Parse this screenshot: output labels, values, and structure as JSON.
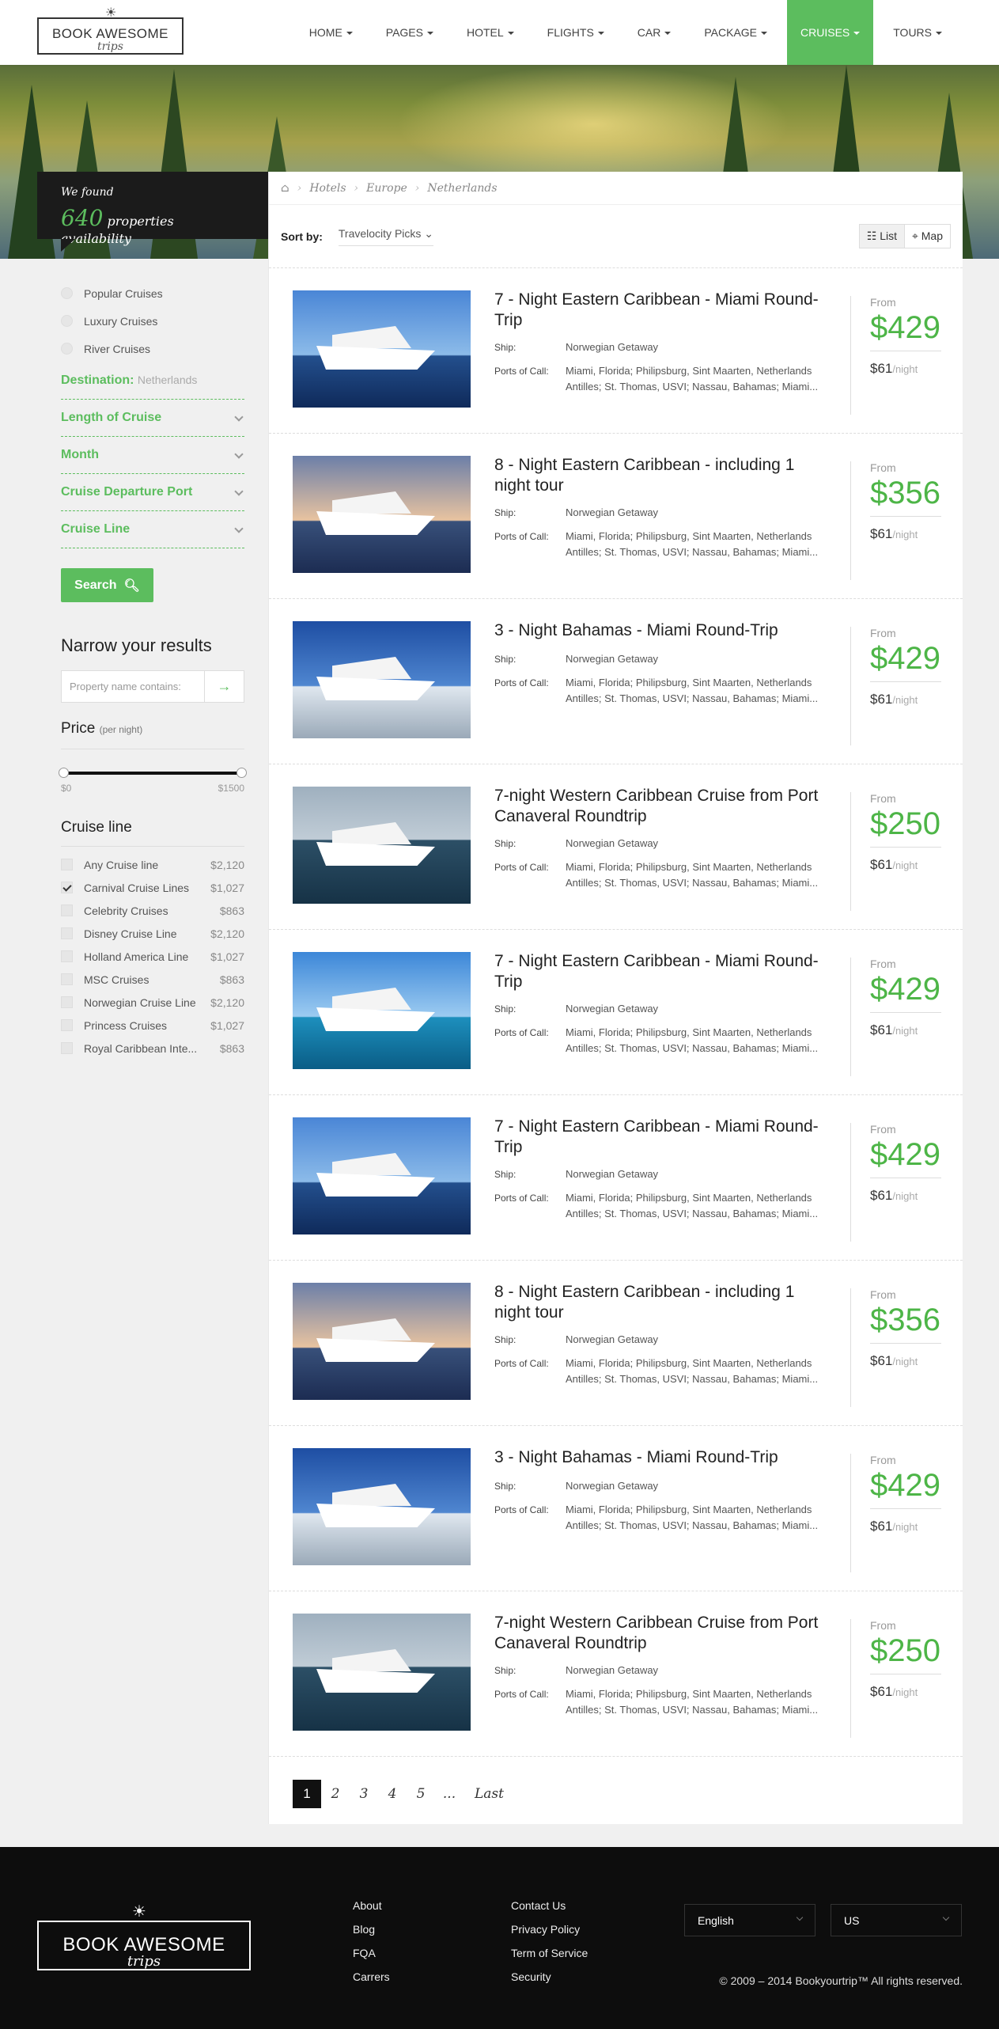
{
  "brand": {
    "name": "BOOK AWESOME",
    "tagline": "trips"
  },
  "nav": [
    {
      "label": "HOME"
    },
    {
      "label": "PAGES"
    },
    {
      "label": "HOTEL"
    },
    {
      "label": "FLIGHTS"
    },
    {
      "label": "CAR"
    },
    {
      "label": "PACKAGE"
    },
    {
      "label": "CRUISES",
      "active": true
    },
    {
      "label": "TOURS"
    }
  ],
  "found": {
    "prefix": "We found",
    "count": "640",
    "suffix": "properties availability"
  },
  "types": [
    "Popular Cruises",
    "Luxury Cruises",
    "River Cruises"
  ],
  "filters": {
    "destination_label": "Destination:",
    "destination_value": "Netherlands",
    "length": "Length of Cruise",
    "month": "Month",
    "port": "Cruise Departure Port",
    "line": "Cruise Line",
    "search": "Search"
  },
  "narrow": {
    "title": "Narrow your results",
    "placeholder": "Property name contains:"
  },
  "price": {
    "title": "Price",
    "unit": "(per night)",
    "min": "$0",
    "max": "$1500",
    "range_min_fraction": 0,
    "range_max_fraction": 1
  },
  "cruise_line": {
    "title": "Cruise line",
    "items": [
      {
        "name": "Any Cruise line",
        "count": "$2,120",
        "checked": false
      },
      {
        "name": "Carnival Cruise Lines",
        "count": "$1,027",
        "checked": true
      },
      {
        "name": "Celebrity Cruises",
        "count": "$863",
        "checked": false
      },
      {
        "name": "Disney Cruise Line",
        "count": "$2,120",
        "checked": false
      },
      {
        "name": "Holland America Line",
        "count": "$1,027",
        "checked": false
      },
      {
        "name": "MSC Cruises",
        "count": "$863",
        "checked": false
      },
      {
        "name": "Norwegian Cruise Line",
        "count": "$2,120",
        "checked": false
      },
      {
        "name": "Princess Cruises",
        "count": "$1,027",
        "checked": false
      },
      {
        "name": "Royal Caribbean Inte...",
        "count": "$863",
        "checked": false
      }
    ]
  },
  "breadcrumb": [
    "Hotels",
    "Europe",
    "Netherlands"
  ],
  "sort": {
    "label": "Sort by:",
    "value": "Travelocity Picks"
  },
  "view": {
    "list": "List",
    "map": "Map"
  },
  "labels": {
    "ship": "Ship:",
    "ports": "Ports of Call:",
    "from": "From",
    "night": "/night"
  },
  "results": [
    {
      "title": "7 - Night Eastern Caribbean - Miami Round-Trip",
      "ship": "Norwegian Getaway",
      "ports": "Miami, Florida; Philipsburg, Sint Maarten, Netherlands Antilles; St. Thomas, USVI; Nassau, Bahamas; Miami...",
      "price": "$429",
      "night": "$61"
    },
    {
      "title": "8 - Night Eastern Caribbean - including 1 night tour",
      "ship": "Norwegian Getaway",
      "ports": "Miami, Florida; Philipsburg, Sint Maarten, Netherlands Antilles; St. Thomas, USVI; Nassau, Bahamas; Miami...",
      "price": "$356",
      "night": "$61"
    },
    {
      "title": "3 - Night Bahamas - Miami Round-Trip",
      "ship": "Norwegian Getaway",
      "ports": "Miami, Florida; Philipsburg, Sint Maarten, Netherlands Antilles; St. Thomas, USVI; Nassau, Bahamas; Miami...",
      "price": "$429",
      "night": "$61"
    },
    {
      "title": "7-night Western Caribbean Cruise from Port Canaveral Roundtrip",
      "ship": "Norwegian Getaway",
      "ports": "Miami, Florida; Philipsburg, Sint Maarten, Netherlands Antilles; St. Thomas, USVI; Nassau, Bahamas; Miami...",
      "price": "$250",
      "night": "$61"
    },
    {
      "title": "7 - Night Eastern Caribbean - Miami Round-Trip",
      "ship": "Norwegian Getaway",
      "ports": "Miami, Florida; Philipsburg, Sint Maarten, Netherlands Antilles; St. Thomas, USVI; Nassau, Bahamas; Miami...",
      "price": "$429",
      "night": "$61"
    },
    {
      "title": "7 - Night Eastern Caribbean - Miami Round-Trip",
      "ship": "Norwegian Getaway",
      "ports": "Miami, Florida; Philipsburg, Sint Maarten, Netherlands Antilles; St. Thomas, USVI; Nassau, Bahamas; Miami...",
      "price": "$429",
      "night": "$61"
    },
    {
      "title": "8 - Night Eastern Caribbean - including 1 night tour",
      "ship": "Norwegian Getaway",
      "ports": "Miami, Florida; Philipsburg, Sint Maarten, Netherlands Antilles; St. Thomas, USVI; Nassau, Bahamas; Miami...",
      "price": "$356",
      "night": "$61"
    },
    {
      "title": "3 - Night Bahamas - Miami Round-Trip",
      "ship": "Norwegian Getaway",
      "ports": "Miami, Florida; Philipsburg, Sint Maarten, Netherlands Antilles; St. Thomas, USVI; Nassau, Bahamas; Miami...",
      "price": "$429",
      "night": "$61"
    },
    {
      "title": "7-night Western Caribbean Cruise from Port Canaveral Roundtrip",
      "ship": "Norwegian Getaway",
      "ports": "Miami, Florida; Philipsburg, Sint Maarten, Netherlands Antilles; St. Thomas, USVI; Nassau, Bahamas; Miami...",
      "price": "$250",
      "night": "$61"
    }
  ],
  "pagination": {
    "pages": [
      "1",
      "2",
      "3",
      "4",
      "5",
      "..."
    ],
    "last": "Last"
  },
  "footer": {
    "col1": [
      "About",
      "Blog",
      "FQA",
      "Carrers"
    ],
    "col2": [
      "Contact Us",
      "Privacy Policy",
      "Term of Service",
      "Security"
    ],
    "language": "English",
    "currency": "US",
    "copyright": "© 2009 – 2014 Bookyourtrip™ All rights reserved."
  },
  "colors": {
    "accent": "#5cbd5e",
    "price": "#4db547",
    "dark": "#1b1b1b"
  }
}
